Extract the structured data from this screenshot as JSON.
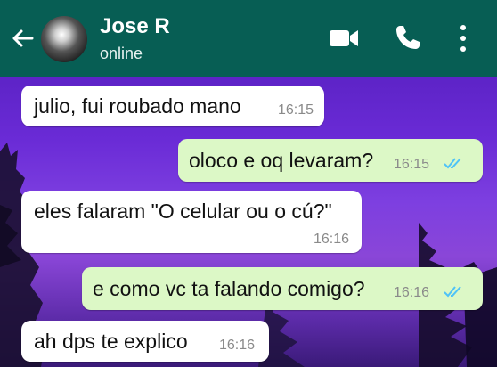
{
  "header": {
    "contact_name": "Jose R",
    "status": "online",
    "background": "#075e54",
    "icons": [
      "back-arrow-icon",
      "video-call-icon",
      "phone-icon",
      "more-options-icon"
    ]
  },
  "messages": [
    {
      "direction": "incoming",
      "text": "julio, fui roubado mano",
      "time": "16:15"
    },
    {
      "direction": "outgoing",
      "text": "oloco e oq levaram?",
      "time": "16:15",
      "read": true
    },
    {
      "direction": "incoming",
      "text": "eles falaram \"O celular ou o cú?\"",
      "time": "16:16"
    },
    {
      "direction": "outgoing",
      "text": "e como vc ta falando comigo?",
      "time": "16:16",
      "read": true
    },
    {
      "direction": "incoming",
      "text": "ah dps te explico",
      "time": "16:16"
    }
  ],
  "colors": {
    "incoming_bubble": "#ffffff",
    "outgoing_bubble": "#dcf8c6",
    "read_ticks": "#4fc3f7"
  }
}
